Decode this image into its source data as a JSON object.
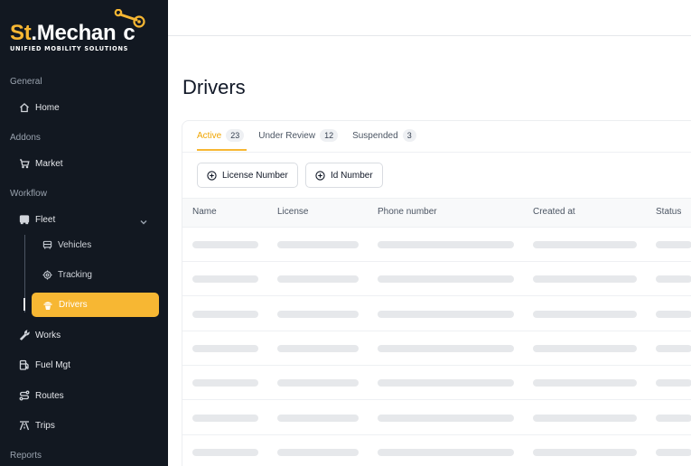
{
  "brand": {
    "name_prefix": "St",
    "name_dot": ".",
    "name_main": "Mechan",
    "name_end": "c",
    "tagline": "UNIFIED MOBILITY SOLUTIONS",
    "accent_color": "#f7b733",
    "sidebar_bg": "#121821"
  },
  "sidebar": {
    "sections": {
      "general": "General",
      "addons": "Addons",
      "workflow": "Workflow",
      "reports": "Reports"
    },
    "items": {
      "home": {
        "label": "Home",
        "icon": "home-icon"
      },
      "market": {
        "label": "Market",
        "icon": "cart-icon"
      },
      "fleet": {
        "label": "Fleet",
        "icon": "bus-icon"
      },
      "vehicles": {
        "label": "Vehicles",
        "icon": "vehicle-icon"
      },
      "tracking": {
        "label": "Tracking",
        "icon": "target-icon"
      },
      "drivers": {
        "label": "Drivers",
        "icon": "driver-icon"
      },
      "works": {
        "label": "Works",
        "icon": "wrench-icon"
      },
      "fuel": {
        "label": "Fuel Mgt",
        "icon": "fuel-icon"
      },
      "routes": {
        "label": "Routes",
        "icon": "route-icon"
      },
      "trips": {
        "label": "Trips",
        "icon": "road-icon"
      }
    }
  },
  "main": {
    "title": "Drivers",
    "tabs": [
      {
        "label": "Active",
        "count": "23"
      },
      {
        "label": "Under Review",
        "count": "12"
      },
      {
        "label": "Suspended",
        "count": "3"
      }
    ],
    "filters": [
      "License Number",
      "Id Number"
    ],
    "columns": [
      "Name",
      "License",
      "Phone number",
      "Created at",
      "Status"
    ],
    "loading_rows": 7
  }
}
